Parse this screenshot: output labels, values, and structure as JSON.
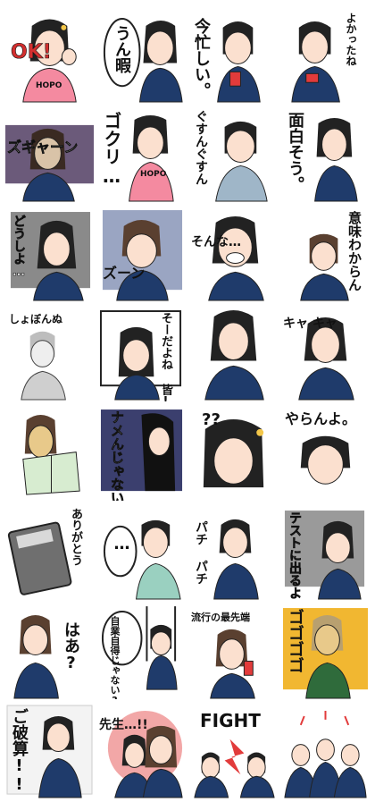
{
  "stickers": [
    {
      "caption": "OK!",
      "shirt": "HOPO"
    },
    {
      "caption": "うん暇"
    },
    {
      "caption": "今忙しい。"
    },
    {
      "caption": "よかったね"
    },
    {
      "caption": "ズギャーン"
    },
    {
      "caption": "ゴクリ…",
      "shirt": "HOPO"
    },
    {
      "caption": "ぐすんぐすん"
    },
    {
      "caption": "面白そう。"
    },
    {
      "caption": "どうしよ…"
    },
    {
      "caption": "ズーン"
    },
    {
      "caption": "そんな…"
    },
    {
      "caption": "意味わからん"
    },
    {
      "caption": "しょぼんぬ"
    },
    {
      "caption": "そーだよね 皆!?"
    },
    {
      "caption": ""
    },
    {
      "caption": "キャ キャ"
    },
    {
      "caption": ""
    },
    {
      "caption": "ナメんじゃないよ"
    },
    {
      "caption": "??"
    },
    {
      "caption": "やらんよ。"
    },
    {
      "caption": ""
    },
    {
      "caption": "ありがとう"
    },
    {
      "caption": "…"
    },
    {
      "caption": "パチ パチ"
    },
    {
      "caption": "テストに出るよ"
    },
    {
      "caption": "はあ?"
    },
    {
      "caption": "自業自得じゃない?"
    },
    {
      "caption": "流行の最先端"
    },
    {
      "caption": "ゴゴゴゴ"
    },
    {
      "caption": "ご破算!!"
    },
    {
      "caption": "先生…!!"
    },
    {
      "caption": "FIGHT"
    },
    {
      "caption": ""
    }
  ]
}
